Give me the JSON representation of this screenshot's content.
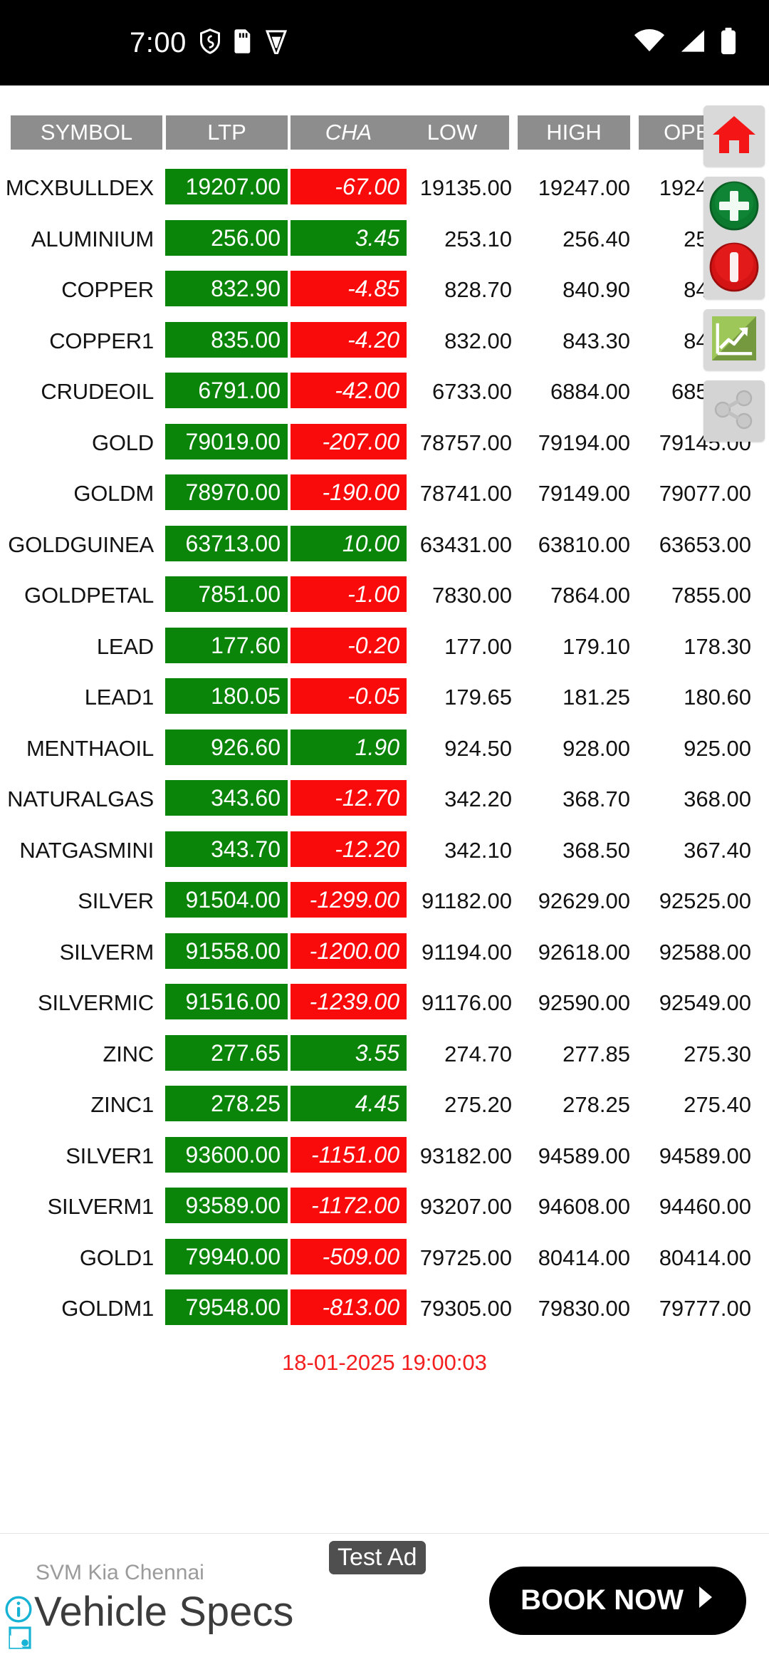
{
  "status_bar": {
    "time": "7:00",
    "left_icons": [
      "shield-icon",
      "sim-card-icon",
      "vpn-key-icon"
    ],
    "right_icons": [
      "wifi-icon",
      "cellular-signal-icon",
      "battery-icon"
    ]
  },
  "colors": {
    "up": "#0a8409",
    "down": "#fa0b0b",
    "header_bg": "#8d8d8d",
    "timestamp": "#f42020",
    "text": "#121212"
  },
  "table": {
    "columns": [
      {
        "key": "symbol",
        "label": "SYMBOL",
        "italic": false
      },
      {
        "key": "ltp",
        "label": "LTP",
        "italic": false
      },
      {
        "key": "cha",
        "label": "CHA",
        "italic": true
      },
      {
        "key": "low",
        "label": "LOW",
        "italic": false
      },
      {
        "key": "high",
        "label": "HIGH",
        "italic": false
      },
      {
        "key": "open",
        "label": "OPEN",
        "italic": false
      }
    ],
    "rows": [
      {
        "symbol": "MCXBULLDEX",
        "ltp": "19207.00",
        "cha": "-67.00",
        "cha_dir": "down",
        "low": "19135.00",
        "high": "19247.00",
        "open": "19247.00"
      },
      {
        "symbol": "ALUMINIUM",
        "ltp": "256.00",
        "cha": "3.45",
        "cha_dir": "up",
        "low": "253.10",
        "high": "256.40",
        "open": "253.90"
      },
      {
        "symbol": "COPPER",
        "ltp": "832.90",
        "cha": "-4.85",
        "cha_dir": "down",
        "low": "828.70",
        "high": "840.90",
        "open": "840.00"
      },
      {
        "symbol": "COPPER1",
        "ltp": "835.00",
        "cha": "-4.20",
        "cha_dir": "down",
        "low": "832.00",
        "high": "843.30",
        "open": "841.50"
      },
      {
        "symbol": "CRUDEOIL",
        "ltp": "6791.00",
        "cha": "-42.00",
        "cha_dir": "down",
        "low": "6733.00",
        "high": "6884.00",
        "open": "6859.00"
      },
      {
        "symbol": "GOLD",
        "ltp": "79019.00",
        "cha": "-207.00",
        "cha_dir": "down",
        "low": "78757.00",
        "high": "79194.00",
        "open": "79145.00"
      },
      {
        "symbol": "GOLDM",
        "ltp": "78970.00",
        "cha": "-190.00",
        "cha_dir": "down",
        "low": "78741.00",
        "high": "79149.00",
        "open": "79077.00"
      },
      {
        "symbol": "GOLDGUINEA",
        "ltp": "63713.00",
        "cha": "10.00",
        "cha_dir": "up",
        "low": "63431.00",
        "high": "63810.00",
        "open": "63653.00"
      },
      {
        "symbol": "GOLDPETAL",
        "ltp": "7851.00",
        "cha": "-1.00",
        "cha_dir": "down",
        "low": "7830.00",
        "high": "7864.00",
        "open": "7855.00"
      },
      {
        "symbol": "LEAD",
        "ltp": "177.60",
        "cha": "-0.20",
        "cha_dir": "down",
        "low": "177.00",
        "high": "179.10",
        "open": "178.30"
      },
      {
        "symbol": "LEAD1",
        "ltp": "180.05",
        "cha": "-0.05",
        "cha_dir": "down",
        "low": "179.65",
        "high": "181.25",
        "open": "180.60"
      },
      {
        "symbol": "MENTHAOIL",
        "ltp": "926.60",
        "cha": "1.90",
        "cha_dir": "up",
        "low": "924.50",
        "high": "928.00",
        "open": "925.00"
      },
      {
        "symbol": "NATURALGAS",
        "ltp": "343.60",
        "cha": "-12.70",
        "cha_dir": "down",
        "low": "342.20",
        "high": "368.70",
        "open": "368.00"
      },
      {
        "symbol": "NATGASMINI",
        "ltp": "343.70",
        "cha": "-12.20",
        "cha_dir": "down",
        "low": "342.10",
        "high": "368.50",
        "open": "367.40"
      },
      {
        "symbol": "SILVER",
        "ltp": "91504.00",
        "cha": "-1299.00",
        "cha_dir": "down",
        "low": "91182.00",
        "high": "92629.00",
        "open": "92525.00"
      },
      {
        "symbol": "SILVERM",
        "ltp": "91558.00",
        "cha": "-1200.00",
        "cha_dir": "down",
        "low": "91194.00",
        "high": "92618.00",
        "open": "92588.00"
      },
      {
        "symbol": "SILVERMIC",
        "ltp": "91516.00",
        "cha": "-1239.00",
        "cha_dir": "down",
        "low": "91176.00",
        "high": "92590.00",
        "open": "92549.00"
      },
      {
        "symbol": "ZINC",
        "ltp": "277.65",
        "cha": "3.55",
        "cha_dir": "up",
        "low": "274.70",
        "high": "277.85",
        "open": "275.30"
      },
      {
        "symbol": "ZINC1",
        "ltp": "278.25",
        "cha": "4.45",
        "cha_dir": "up",
        "low": "275.20",
        "high": "278.25",
        "open": "275.40"
      },
      {
        "symbol": "SILVER1",
        "ltp": "93600.00",
        "cha": "-1151.00",
        "cha_dir": "down",
        "low": "93182.00",
        "high": "94589.00",
        "open": "94589.00"
      },
      {
        "symbol": "SILVERM1",
        "ltp": "93589.00",
        "cha": "-1172.00",
        "cha_dir": "down",
        "low": "93207.00",
        "high": "94608.00",
        "open": "94460.00"
      },
      {
        "symbol": "GOLD1",
        "ltp": "79940.00",
        "cha": "-509.00",
        "cha_dir": "down",
        "low": "79725.00",
        "high": "80414.00",
        "open": "80414.00"
      },
      {
        "symbol": "GOLDM1",
        "ltp": "79548.00",
        "cha": "-813.00",
        "cha_dir": "down",
        "low": "79305.00",
        "high": "79830.00",
        "open": "79777.00"
      }
    ],
    "timestamp": "18-01-2025 19:00:03"
  },
  "fab": {
    "home": "home-icon",
    "add": "plus-circle-icon",
    "remove": "minus-circle-icon",
    "chart": "chart-icon",
    "share": "share-icon"
  },
  "ad": {
    "advertiser": "SVM Kia Chennai",
    "headline": "Vehicle Specs",
    "badge": "Test Ad",
    "cta": "BOOK NOW",
    "cta_arrow": "▶"
  }
}
